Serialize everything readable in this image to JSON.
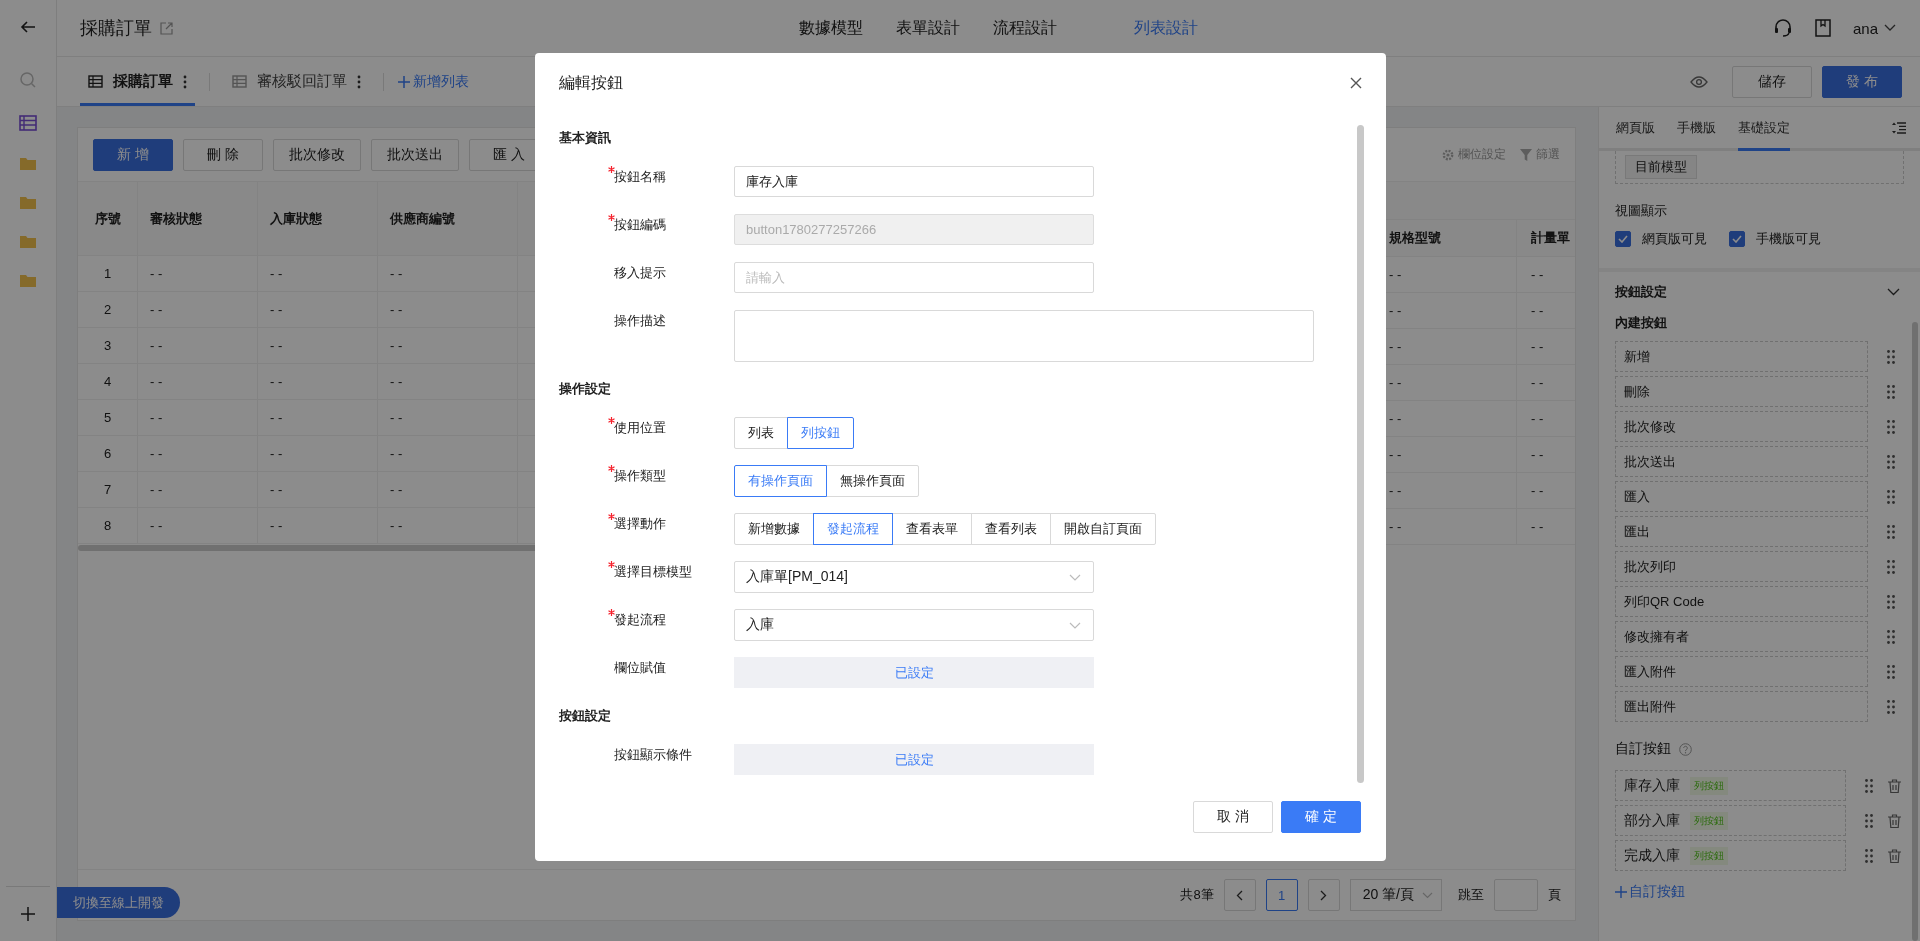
{
  "header": {
    "title": "採購訂單",
    "nav": [
      {
        "label": "數據模型",
        "selected": false
      },
      {
        "label": "表單設計",
        "selected": false
      },
      {
        "label": "流程設計",
        "selected": false
      },
      {
        "label": "列表設計",
        "selected": true
      }
    ],
    "user": "ana"
  },
  "list_tabs": {
    "tabs": [
      {
        "label": "採購訂單",
        "selected": true
      },
      {
        "label": "審核駁回訂單",
        "selected": false
      }
    ],
    "add_label": "新增列表",
    "save": "儲存",
    "publish": "發 布"
  },
  "toolbar": {
    "buttons": [
      {
        "label": "新 增",
        "kind": "primary"
      },
      {
        "label": "刪 除",
        "kind": "default"
      },
      {
        "label": "批次修改",
        "kind": "default"
      },
      {
        "label": "批次送出",
        "kind": "default"
      },
      {
        "label": "匯 入",
        "kind": "default"
      }
    ],
    "tools": [
      {
        "label": "欄位設定",
        "kind": "columns"
      },
      {
        "label": "篩選",
        "kind": "filter"
      }
    ]
  },
  "table": {
    "left_columns": [
      "序號",
      "審核狀態",
      "入庫狀態",
      "供應商編號"
    ],
    "right_columns": [
      "規格型號",
      "計量單"
    ],
    "rows": [
      {
        "index": "1",
        "cells": [
          "- -",
          "- -",
          "- -"
        ],
        "right_cells": [
          "- -",
          "- -"
        ]
      },
      {
        "index": "2",
        "cells": [
          "- -",
          "- -",
          "- -"
        ],
        "right_cells": [
          "- -",
          "- -"
        ]
      },
      {
        "index": "3",
        "cells": [
          "- -",
          "- -",
          "- -"
        ],
        "right_cells": [
          "- -",
          "- -"
        ]
      },
      {
        "index": "4",
        "cells": [
          "- -",
          "- -",
          "- -"
        ],
        "right_cells": [
          "- -",
          "- -"
        ]
      },
      {
        "index": "5",
        "cells": [
          "- -",
          "- -",
          "- -"
        ],
        "right_cells": [
          "- -",
          "- -"
        ]
      },
      {
        "index": "6",
        "cells": [
          "- -",
          "- -",
          "- -"
        ],
        "right_cells": [
          "- -",
          "- -"
        ]
      },
      {
        "index": "7",
        "cells": [
          "- -",
          "- -",
          "- -"
        ],
        "right_cells": [
          "- -",
          "- -"
        ]
      },
      {
        "index": "8",
        "cells": [
          "- -",
          "- -",
          "- -"
        ],
        "right_cells": [
          "- -",
          "- -"
        ]
      }
    ]
  },
  "pagination": {
    "total": "共8筆",
    "pages": [
      {
        "label": "1",
        "selected": true
      }
    ],
    "page_size": "20 筆/頁",
    "jump_label": "跳至",
    "page_suffix": "頁"
  },
  "switch_button": "切換至線上開發",
  "panel": {
    "tabs": [
      {
        "label": "網頁版",
        "selected": false
      },
      {
        "label": "手機版",
        "selected": false
      },
      {
        "label": "基礎設定",
        "selected": true
      }
    ],
    "model_chip": "目前模型",
    "view": {
      "title": "視圖顯示",
      "options": [
        {
          "label": "網頁版可見",
          "checked": true
        },
        {
          "label": "手機版可見",
          "checked": true
        }
      ]
    },
    "buttons": {
      "title": "按鈕設定",
      "expanded": true,
      "builtin_title": "內建按鈕",
      "builtin": [
        "新增",
        "刪除",
        "批次修改",
        "批次送出",
        "匯入",
        "匯出",
        "批次列印",
        "列印QR Code",
        "修改擁有者",
        "匯入附件",
        "匯出附件"
      ],
      "custom_title": "自訂按鈕",
      "custom": [
        {
          "label": "庫存入庫",
          "tag": "列按鈕"
        },
        {
          "label": "部分入庫",
          "tag": "列按鈕"
        },
        {
          "label": "完成入庫",
          "tag": "列按鈕"
        }
      ],
      "add_custom": "自訂按鈕"
    }
  },
  "modal": {
    "title": "編輯按鈕",
    "sections": [
      {
        "title": "基本資訊",
        "fields": [
          {
            "kind": "text",
            "label": "按鈕名稱",
            "required": true,
            "disabled": false,
            "value": "庫存入庫"
          },
          {
            "kind": "text",
            "label": "按鈕編碼",
            "required": true,
            "disabled": true,
            "value": "button1780277257266"
          },
          {
            "kind": "text",
            "label": "移入提示",
            "required": false,
            "disabled": false,
            "placeholder": "請輸入"
          },
          {
            "kind": "textarea",
            "label": "操作描述",
            "required": false
          }
        ]
      },
      {
        "title": "操作設定",
        "fields": [
          {
            "kind": "segmented",
            "label": "使用位置",
            "required": true,
            "options": [
              {
                "label": "列表",
                "selected": false
              },
              {
                "label": "列按鈕",
                "selected": true
              }
            ]
          },
          {
            "kind": "segmented",
            "label": "操作類型",
            "required": true,
            "options": [
              {
                "label": "有操作頁面",
                "selected": true
              },
              {
                "label": "無操作頁面",
                "selected": false
              }
            ]
          },
          {
            "kind": "segmented",
            "label": "選擇動作",
            "required": true,
            "options": [
              {
                "label": "新增數據",
                "selected": false
              },
              {
                "label": "發起流程",
                "selected": true
              },
              {
                "label": "查看表單",
                "selected": false
              },
              {
                "label": "查看列表",
                "selected": false
              },
              {
                "label": "開啟自訂頁面",
                "selected": false
              }
            ]
          },
          {
            "kind": "select",
            "label": "選擇目標模型",
            "required": true,
            "value": "入庫單[PM_014]"
          },
          {
            "kind": "select",
            "label": "發起流程",
            "required": true,
            "value": "入庫"
          },
          {
            "kind": "setting",
            "label": "欄位賦值",
            "required": false,
            "value": "已設定"
          }
        ]
      },
      {
        "title": "按鈕設定",
        "fields": [
          {
            "kind": "setting",
            "label": "按鈕顯示條件",
            "required": false,
            "value": "已設定"
          }
        ]
      }
    ],
    "buttons": [
      {
        "label": "取 消",
        "kind": "default"
      },
      {
        "label": "確 定",
        "kind": "primary"
      }
    ]
  }
}
